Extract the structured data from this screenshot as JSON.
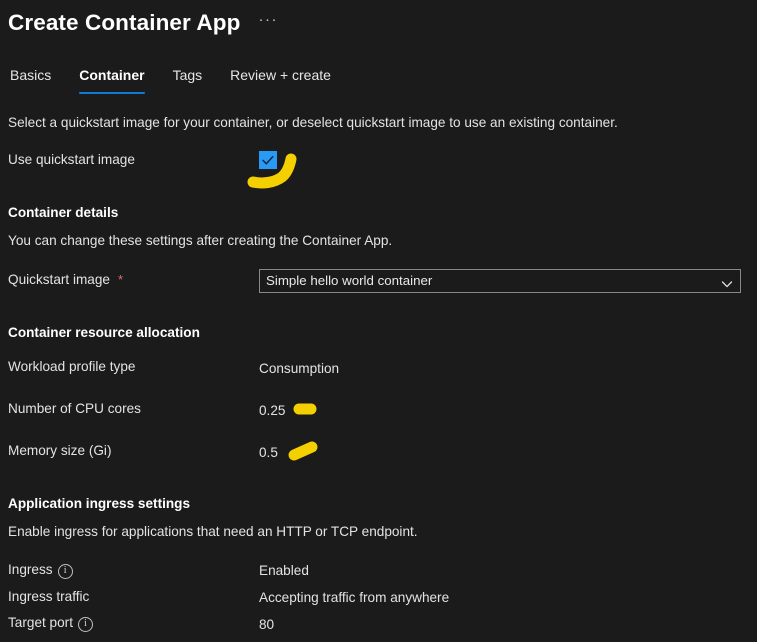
{
  "header": {
    "title": "Create Container App",
    "more_menu": "···"
  },
  "tabs": [
    {
      "label": "Basics",
      "active": false
    },
    {
      "label": "Container",
      "active": true
    },
    {
      "label": "Tags",
      "active": false
    },
    {
      "label": "Review + create",
      "active": false
    }
  ],
  "quickstart": {
    "description": "Select a quickstart image for your container, or deselect quickstart image to use an existing container.",
    "checkbox_label": "Use quickstart image",
    "checkbox_checked": true
  },
  "container_details": {
    "heading": "Container details",
    "description": "You can change these settings after creating the Container App.",
    "quickstart_image_label": "Quickstart image",
    "quickstart_image_required": "*",
    "quickstart_image_value": "Simple hello world container"
  },
  "resource_allocation": {
    "heading": "Container resource allocation",
    "rows": [
      {
        "label": "Workload profile type",
        "value": "Consumption"
      },
      {
        "label": "Number of CPU cores",
        "value": "0.25"
      },
      {
        "label": "Memory size (Gi)",
        "value": "0.5"
      }
    ]
  },
  "ingress": {
    "heading": "Application ingress settings",
    "description": "Enable ingress for applications that need an HTTP or TCP endpoint.",
    "rows": [
      {
        "label": "Ingress",
        "info": true,
        "value": "Enabled"
      },
      {
        "label": "Ingress traffic",
        "info": false,
        "value": "Accepting traffic from anywhere"
      },
      {
        "label": "Target port",
        "info": true,
        "value": "80"
      }
    ]
  },
  "icons": {
    "checkbox_check": "check-icon",
    "dropdown_chevron": "chevron-down-icon",
    "info": "info-icon",
    "more": "ellipsis-icon"
  },
  "annotations": {
    "color": "#f5d000",
    "marks": [
      {
        "name": "swoosh-mark-quickstart-checkbox",
        "shape": "curved-stroke"
      },
      {
        "name": "pill-mark-cpu-cores",
        "shape": "pill"
      },
      {
        "name": "pill-mark-memory-size",
        "shape": "pill"
      }
    ]
  },
  "colors": {
    "background": "#1b1b1b",
    "accent": "#0f7bd6",
    "checkbox": "#2899f5",
    "required": "#e06c6c",
    "highlight": "#f5d000"
  }
}
